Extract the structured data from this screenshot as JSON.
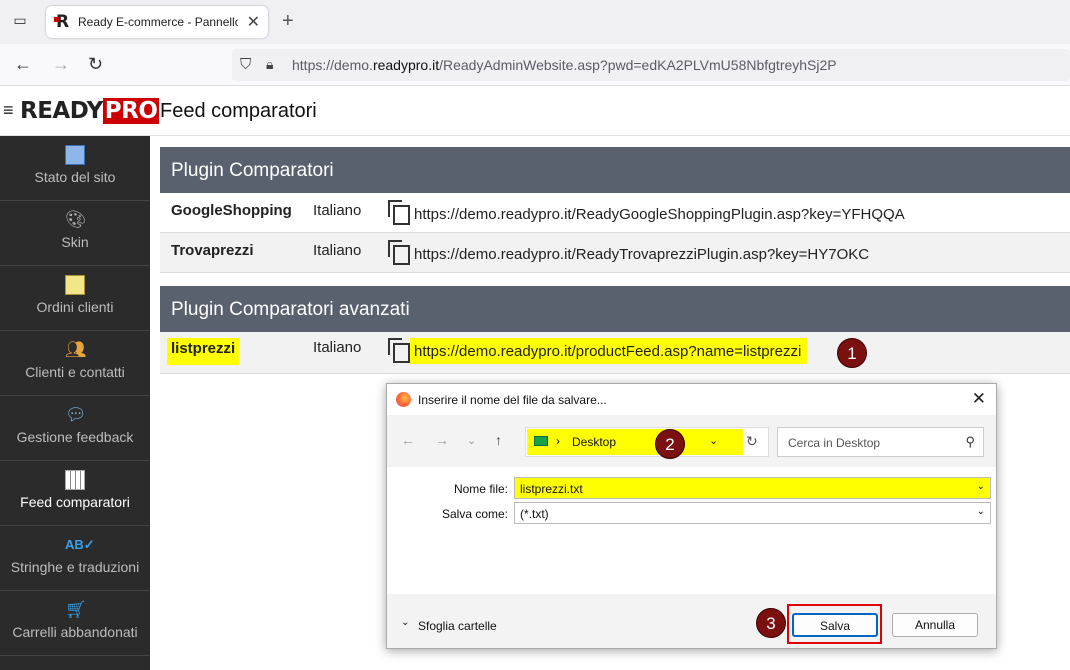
{
  "browser": {
    "tab_title": "Ready E-commerce - Pannello",
    "url_prefix": "https://demo.",
    "url_domain": "readypro.it",
    "url_suffix": "/ReadyAdminWebsite.asp?pwd=edKA2PLVmU58NbfgtreyhSj2P"
  },
  "header": {
    "logo_ready": "READY",
    "logo_pro": "PRO",
    "page_title": "Feed comparatori"
  },
  "sidebar": {
    "items": [
      {
        "label": "Stato del sito",
        "icon": "site-status-icon"
      },
      {
        "label": "Skin",
        "icon": "palette-icon"
      },
      {
        "label": "Ordini clienti",
        "icon": "orders-icon"
      },
      {
        "label": "Clienti e contatti",
        "icon": "contacts-icon"
      },
      {
        "label": "Gestione feedback",
        "icon": "feedback-icon"
      },
      {
        "label": "Feed comparatori",
        "icon": "grid-icon"
      },
      {
        "label": "Stringhe e traduzioni",
        "icon": "translate-icon"
      },
      {
        "label": "Carrelli abbandonati",
        "icon": "cart-icon"
      }
    ]
  },
  "plugins": {
    "title": "Plugin Comparatori",
    "rows": [
      {
        "name": "GoogleShopping",
        "lang": "Italiano",
        "link": "https://demo.readypro.it/ReadyGoogleShoppingPlugin.asp?key=YFHQQA"
      },
      {
        "name": "Trovaprezzi",
        "lang": "Italiano",
        "link": "https://demo.readypro.it/ReadyTrovaprezziPlugin.asp?key=HY7OKC"
      }
    ]
  },
  "advanced": {
    "title": "Plugin Comparatori avanzati",
    "rows": [
      {
        "name": "listprezzi",
        "lang": "Italiano",
        "link": "https://demo.readypro.it/productFeed.asp?name=listprezzi"
      }
    ]
  },
  "badges": [
    "1",
    "2",
    "3"
  ],
  "dialog": {
    "title": "Inserire il nome del file da salvare...",
    "location": "Desktop",
    "search_placeholder": "Cerca in Desktop",
    "filename_label": "Nome file:",
    "filename_value": "listprezzi.txt",
    "savetype_label": "Salva come:",
    "savetype_value": "(*.txt)",
    "browse_folders": "Sfoglia cartelle",
    "save_button": "Salva",
    "cancel_button": "Annulla"
  },
  "colors": {
    "highlight": "#ffff00",
    "badge": "#7a1010",
    "redbox": "#e00000",
    "sidebar": "#2b2b2b",
    "panel_header": "#5a616e"
  }
}
